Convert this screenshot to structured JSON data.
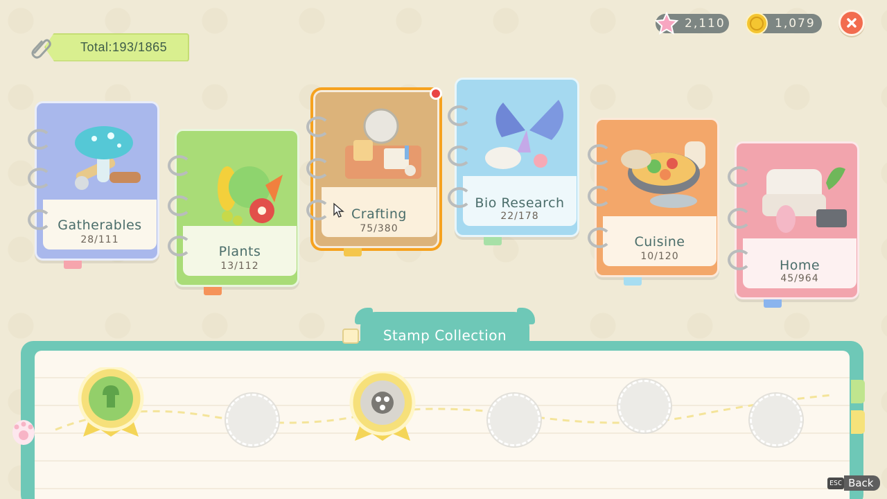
{
  "header": {
    "total_label": "Total:193/1865",
    "stars": "2,110",
    "coins": "1,079"
  },
  "books": [
    {
      "name": "Gatherables",
      "count": "28/111"
    },
    {
      "name": "Plants",
      "count": "13/112"
    },
    {
      "name": "Crafting",
      "count": "75/380"
    },
    {
      "name": "Bio Research",
      "count": "22/178"
    },
    {
      "name": "Cuisine",
      "count": "10/120"
    },
    {
      "name": "Home",
      "count": "45/964"
    }
  ],
  "stamp_panel": {
    "title": "Stamp Collection"
  },
  "footer": {
    "esc_key": "ESC",
    "back_label": "Back"
  },
  "colors": {
    "gatherables": "#a9b8ec",
    "plants": "#a9dc77",
    "crafting": "#dcb37a",
    "bio_research": "#a5d9f0",
    "cuisine": "#f3a76a",
    "home": "#f2a4ad",
    "accent_teal": "#6ec8b7",
    "close_red": "#f26c4f"
  }
}
